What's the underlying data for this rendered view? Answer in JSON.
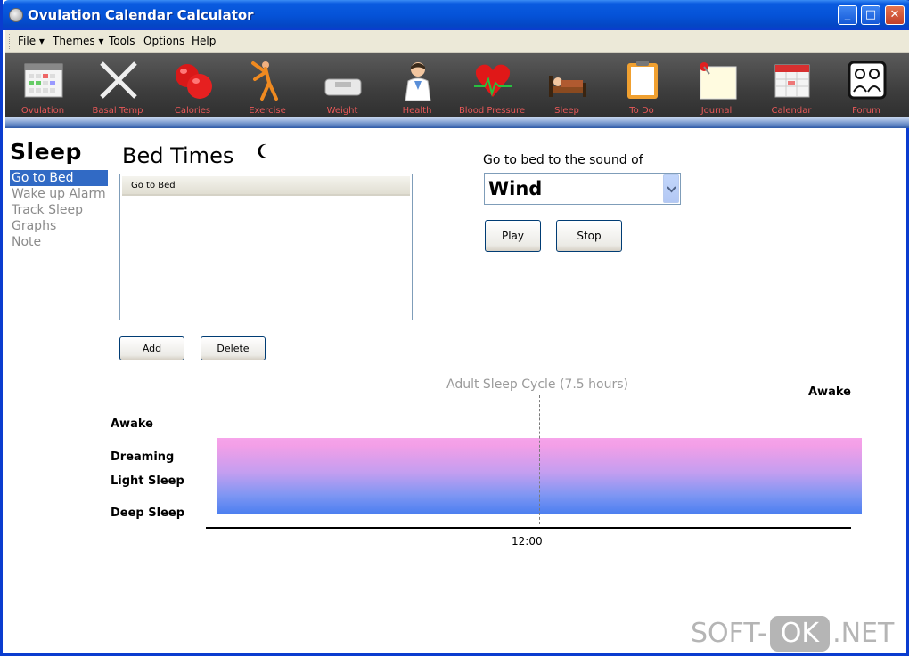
{
  "window": {
    "title": "Ovulation Calendar Calculator",
    "minimize": "_",
    "maximize": "□",
    "close": "✕"
  },
  "menu": {
    "items": [
      "File ▾",
      "Themes ▾",
      "Tools",
      "Options",
      "Help"
    ]
  },
  "toolbar": {
    "items": [
      {
        "label": "Ovulation",
        "icon": "ovulation-calendar-icon"
      },
      {
        "label": "Basal Temp",
        "icon": "basal-temp-icon"
      },
      {
        "label": "Calories",
        "icon": "apples-icon"
      },
      {
        "label": "Exercise",
        "icon": "exercise-icon"
      },
      {
        "label": "Weight",
        "icon": "scale-icon"
      },
      {
        "label": "Health",
        "icon": "doctor-icon"
      },
      {
        "label": "Blood Pressure",
        "icon": "heart-icon"
      },
      {
        "label": "Sleep",
        "icon": "bed-icon"
      },
      {
        "label": "To Do",
        "icon": "clipboard-icon"
      },
      {
        "label": "Journal",
        "icon": "note-pin-icon"
      },
      {
        "label": "Calendar",
        "icon": "calendar-icon"
      },
      {
        "label": "Forum",
        "icon": "forum-icon"
      }
    ]
  },
  "sidebar": {
    "title": "Sleep",
    "items": [
      {
        "label": "Go to Bed",
        "active": true
      },
      {
        "label": "Wake up Alarm",
        "active": false
      },
      {
        "label": "Track Sleep",
        "active": false
      },
      {
        "label": "Graphs",
        "active": false
      },
      {
        "label": "Note",
        "active": false
      }
    ]
  },
  "bed_times": {
    "title": "Bed Times",
    "list_header": "Go to Bed",
    "add_label": "Add",
    "delete_label": "Delete"
  },
  "sound": {
    "label": "Go to bed to the sound of",
    "selected": "Wind",
    "play_label": "Play",
    "stop_label": "Stop"
  },
  "chart_data": {
    "type": "area",
    "title": "Adult Sleep Cycle (7.5 hours)",
    "y_categories": [
      "Awake",
      "Dreaming",
      "Light Sleep",
      "Deep Sleep"
    ],
    "top_right_label": "Awake",
    "x_tick_labels": [
      "12:00"
    ],
    "colors": {
      "top": "#f6a4ea",
      "bottom": "#4a7ef0"
    }
  },
  "watermark": {
    "left": "SOFT-",
    "middle": "OK",
    "right": ".NET"
  }
}
